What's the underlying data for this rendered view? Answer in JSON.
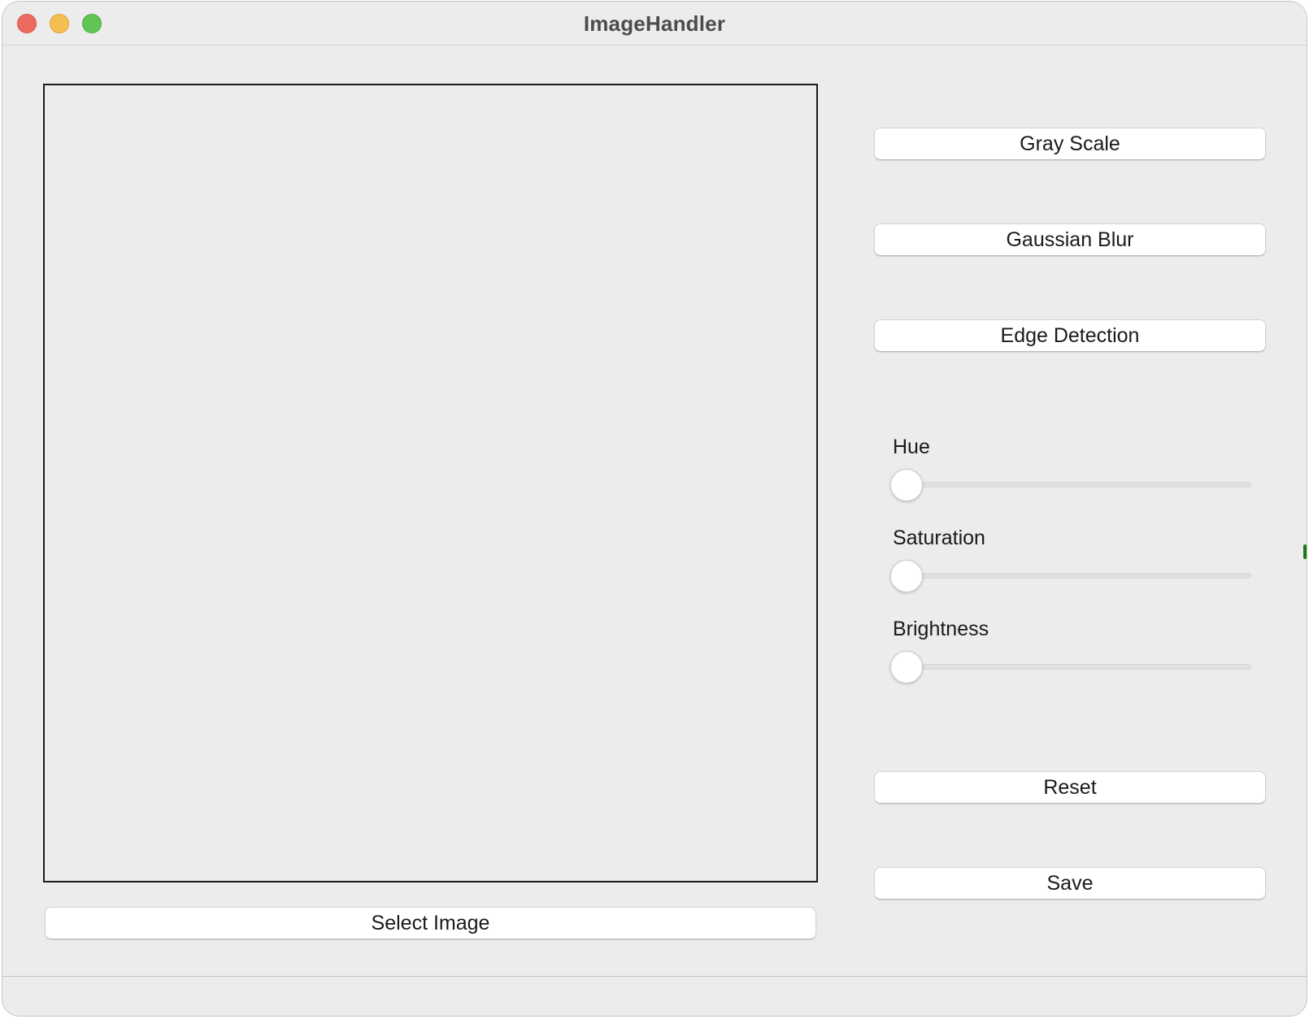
{
  "window": {
    "title": "ImageHandler"
  },
  "buttons": {
    "gray_scale": "Gray Scale",
    "gaussian_blur": "Gaussian Blur",
    "edge_detection": "Edge Detection",
    "reset": "Reset",
    "save": "Save",
    "select_image": "Select Image"
  },
  "sliders": [
    {
      "label": "Hue",
      "value": 0
    },
    {
      "label": "Saturation",
      "value": 0
    },
    {
      "label": "Brightness",
      "value": 0
    }
  ],
  "colors": {
    "close": "#ed6a5e",
    "minimize": "#f5bf4f",
    "zoom": "#61c554",
    "window_bg": "#ececec"
  }
}
